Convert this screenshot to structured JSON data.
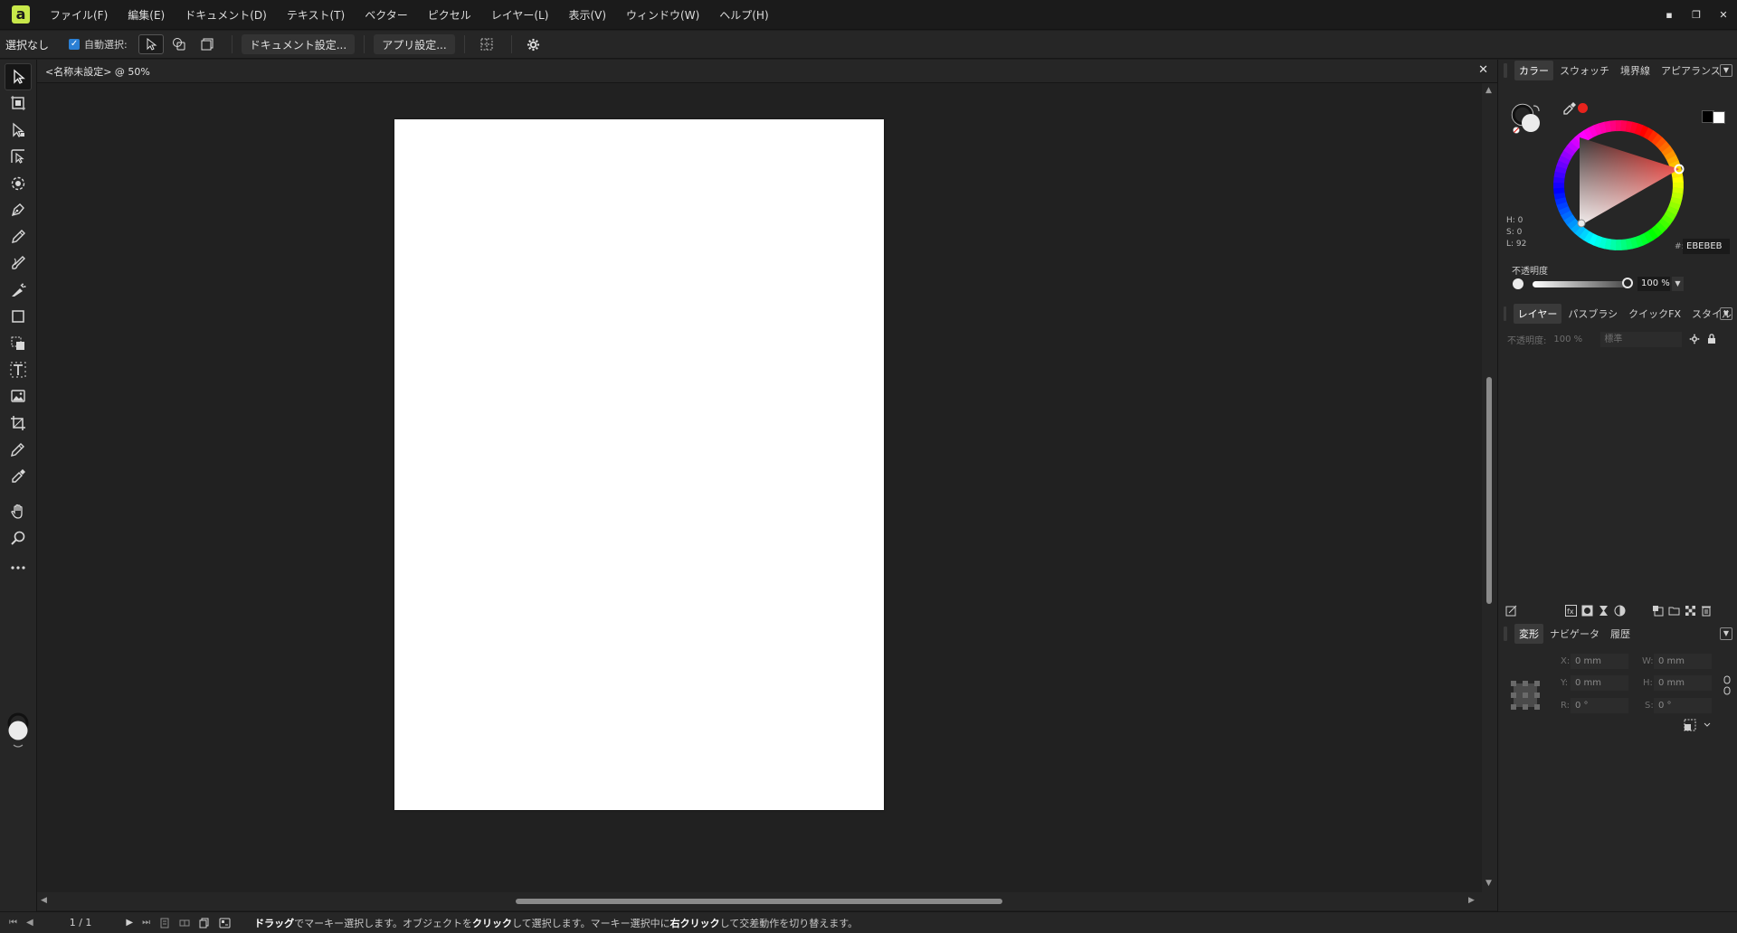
{
  "app": {
    "menu": [
      "ファイル(F)",
      "編集(E)",
      "ドキュメント(D)",
      "テキスト(T)",
      "ベクター",
      "ピクセル",
      "レイヤー(L)",
      "表示(V)",
      "ウィンドウ(W)",
      "ヘルプ(H)"
    ],
    "window_controls": {
      "minimize": "▪",
      "restore": "❐",
      "close": "✕"
    }
  },
  "context_bar": {
    "selection_status": "選択なし",
    "auto_select_label": "自動選択:",
    "auto_select_checked": true,
    "document_setup_button": "ドキュメント設定...",
    "app_settings_button": "アプリ設定..."
  },
  "tools": [
    {
      "name": "move-tool",
      "icon": "arrow-pointer-icon",
      "active": true
    },
    {
      "name": "artboard-tool",
      "icon": "artboard-icon"
    },
    {
      "name": "node-tool",
      "icon": "node-arrow-icon"
    },
    {
      "name": "corner-tool",
      "icon": "corner-icon"
    },
    {
      "name": "point-transform-tool",
      "icon": "point-transform-icon"
    },
    {
      "name": "pen-tool",
      "icon": "pen-icon"
    },
    {
      "name": "pencil-tool",
      "icon": "pencil-icon"
    },
    {
      "name": "vector-brush-tool",
      "icon": "vector-brush-icon"
    },
    {
      "name": "fill-tool",
      "icon": "fill-icon"
    },
    {
      "name": "rectangle-tool",
      "icon": "rectangle-icon"
    },
    {
      "name": "shape-builder-tool",
      "icon": "shape-builder-icon"
    },
    {
      "name": "text-tool",
      "icon": "text-icon"
    },
    {
      "name": "image-tool",
      "icon": "image-icon"
    },
    {
      "name": "crop-tool",
      "icon": "crop-icon"
    },
    {
      "name": "transparency-tool",
      "icon": "transparency-icon"
    },
    {
      "name": "color-picker-tool",
      "icon": "eyedropper-icon"
    },
    {
      "name": "hand-tool",
      "icon": "hand-icon"
    },
    {
      "name": "zoom-tool",
      "icon": "zoom-icon"
    },
    {
      "name": "more-tools",
      "icon": "more-icon"
    }
  ],
  "document": {
    "tab_title": "<名称未設定> @ 50%",
    "close_label": "✕"
  },
  "statusbar": {
    "page_count": "1 / 1",
    "hint": [
      {
        "text": "ドラッグ",
        "bold": true
      },
      {
        "text": "でマーキー選択します。オブジェクトを",
        "bold": false
      },
      {
        "text": "クリック",
        "bold": true
      },
      {
        "text": "して選択します。マーキー選択中に",
        "bold": false
      },
      {
        "text": "右クリック",
        "bold": true
      },
      {
        "text": "して交差動作を切り替えます。",
        "bold": false
      }
    ]
  },
  "color_panel": {
    "tabs": [
      "カラー",
      "スウォッチ",
      "境界線",
      "アピアランス"
    ],
    "active_tab": "カラー",
    "hsl": {
      "h": "H: 0",
      "s": "S: 0",
      "l": "L: 92"
    },
    "hex_label": "#:",
    "hex_value": "EBEBEB",
    "opacity_label": "不透明度",
    "opacity_value": "100 %",
    "opacity_fraction": 1.0,
    "accent_color": "#e8231d",
    "current_fill": "#ebebeb"
  },
  "layers_panel": {
    "tabs": [
      "レイヤー",
      "パスブラシ",
      "クイックFX",
      "スタイル"
    ],
    "active_tab": "レイヤー",
    "opacity_label": "不透明度:",
    "opacity_value": "100 %",
    "blend_mode": "標準"
  },
  "transform_panel": {
    "tabs": [
      "変形",
      "ナビゲータ",
      "履歴"
    ],
    "active_tab": "変形",
    "fields": [
      {
        "label": "X:",
        "value": "0 mm"
      },
      {
        "label": "W:",
        "value": "0 mm"
      },
      {
        "label": "Y:",
        "value": "0 mm"
      },
      {
        "label": "H:",
        "value": "0 mm"
      },
      {
        "label": "R:",
        "value": "0 °"
      },
      {
        "label": "S:",
        "value": "0 °"
      }
    ]
  }
}
